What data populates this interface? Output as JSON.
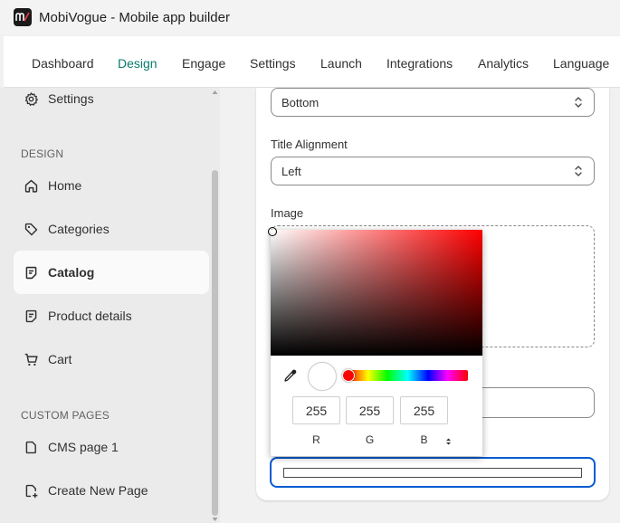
{
  "window": {
    "title": "MobiVogue - Mobile app builder",
    "logo_text": "m/"
  },
  "nav": {
    "tabs": [
      {
        "label": "Dashboard"
      },
      {
        "label": "Design",
        "active": true
      },
      {
        "label": "Engage"
      },
      {
        "label": "Settings"
      },
      {
        "label": "Launch"
      },
      {
        "label": "Integrations"
      },
      {
        "label": "Analytics"
      },
      {
        "label": "Language"
      }
    ],
    "active_color": "#0a7b6b"
  },
  "sidebar": {
    "top_item": {
      "label": "Settings",
      "icon": "gear-icon"
    },
    "design_heading": "DESIGN",
    "design_items": [
      {
        "label": "Home",
        "icon": "home-icon"
      },
      {
        "label": "Categories",
        "icon": "tag-icon"
      },
      {
        "label": "Catalog",
        "icon": "catalog-icon",
        "active": true
      },
      {
        "label": "Product details",
        "icon": "catalog-icon"
      },
      {
        "label": "Cart",
        "icon": "cart-icon"
      }
    ],
    "custom_heading": "CUSTOM PAGES",
    "custom_items": [
      {
        "label": "CMS page 1",
        "icon": "page-icon"
      },
      {
        "label": "Create New Page",
        "icon": "add-page-icon"
      }
    ]
  },
  "form": {
    "position_select": {
      "value": "Bottom"
    },
    "title_alignment": {
      "label": "Title Alignment",
      "value": "Left"
    },
    "image": {
      "label": "Image"
    }
  },
  "color_picker": {
    "color": "#ffffff",
    "hue_color": "#ff0000",
    "r": "255",
    "g": "255",
    "b": "255",
    "r_label": "R",
    "g_label": "G",
    "b_label": "B",
    "focus_color": "#005bd3"
  }
}
